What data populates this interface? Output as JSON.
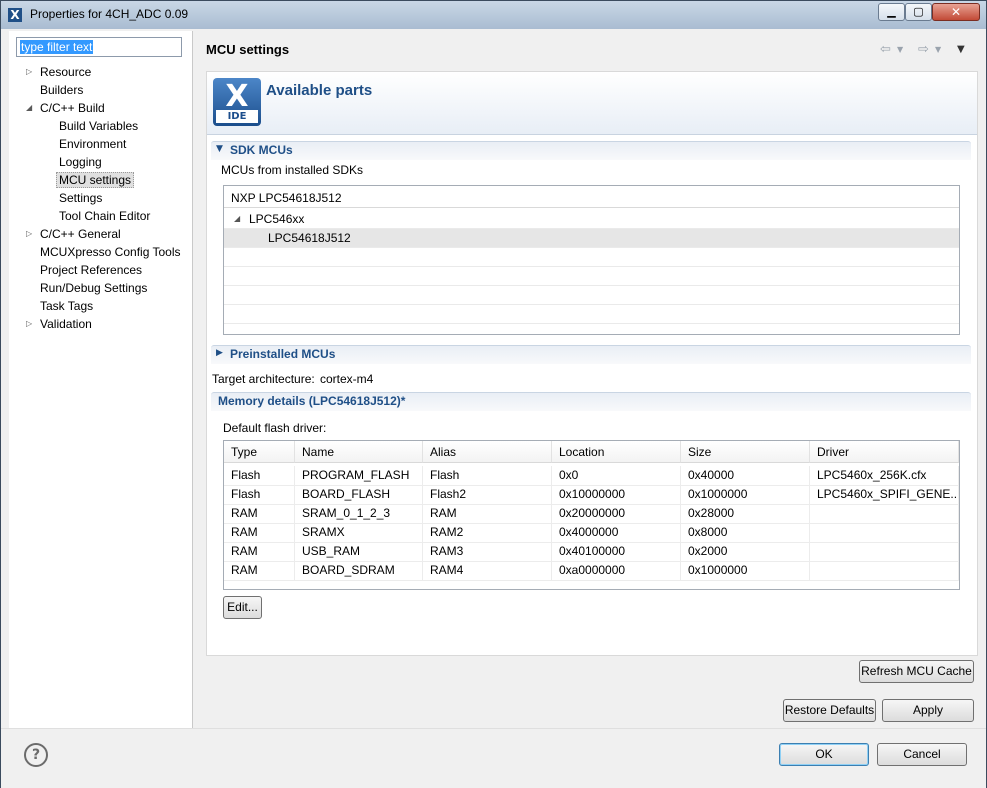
{
  "window": {
    "title": "Properties for 4CH_ADC 0.09"
  },
  "filter": {
    "placeholder": "type filter text"
  },
  "tree": [
    {
      "label": "Resource",
      "level": 0,
      "twisty": "collapsed"
    },
    {
      "label": "Builders",
      "level": 0,
      "twisty": "none"
    },
    {
      "label": "C/C++ Build",
      "level": 0,
      "twisty": "expanded"
    },
    {
      "label": "Build Variables",
      "level": 1,
      "twisty": "none"
    },
    {
      "label": "Environment",
      "level": 1,
      "twisty": "none"
    },
    {
      "label": "Logging",
      "level": 1,
      "twisty": "none"
    },
    {
      "label": "MCU settings",
      "level": 1,
      "twisty": "none",
      "selected": true
    },
    {
      "label": "Settings",
      "level": 1,
      "twisty": "none"
    },
    {
      "label": "Tool Chain Editor",
      "level": 1,
      "twisty": "none"
    },
    {
      "label": "C/C++ General",
      "level": 0,
      "twisty": "collapsed"
    },
    {
      "label": "MCUXpresso Config Tools",
      "level": 0,
      "twisty": "none"
    },
    {
      "label": "Project References",
      "level": 0,
      "twisty": "none"
    },
    {
      "label": "Run/Debug Settings",
      "level": 0,
      "twisty": "none"
    },
    {
      "label": "Task Tags",
      "level": 0,
      "twisty": "none"
    },
    {
      "label": "Validation",
      "level": 0,
      "twisty": "collapsed"
    }
  ],
  "page": {
    "title": "MCU settings"
  },
  "banner": {
    "logo_letter": "X",
    "logo_text": "IDE",
    "heading": "Available parts"
  },
  "sdk": {
    "header": "SDK MCUs",
    "subtitle": "MCUs from installed SDKs",
    "tree_header": "NXP LPC54618J512",
    "family": "LPC546xx",
    "part": "LPC54618J512"
  },
  "preinstalled": {
    "header": "Preinstalled MCUs"
  },
  "target": {
    "label": "Target architecture:",
    "value": "cortex-m4"
  },
  "memory": {
    "header": "Memory details (LPC54618J512)*",
    "flash_driver_label": "Default flash driver:",
    "columns": [
      "Type",
      "Name",
      "Alias",
      "Location",
      "Size",
      "Driver"
    ],
    "rows": [
      [
        "Flash",
        "PROGRAM_FLASH",
        "Flash",
        "0x0",
        "0x40000",
        "LPC5460x_256K.cfx"
      ],
      [
        "Flash",
        "BOARD_FLASH",
        "Flash2",
        "0x10000000",
        "0x1000000",
        "LPC5460x_SPIFI_GENE..."
      ],
      [
        "RAM",
        "SRAM_0_1_2_3",
        "RAM",
        "0x20000000",
        "0x28000",
        ""
      ],
      [
        "RAM",
        "SRAMX",
        "RAM2",
        "0x4000000",
        "0x8000",
        ""
      ],
      [
        "RAM",
        "USB_RAM",
        "RAM3",
        "0x40100000",
        "0x2000",
        ""
      ],
      [
        "RAM",
        "BOARD_SDRAM",
        "RAM4",
        "0xa0000000",
        "0x1000000",
        ""
      ]
    ],
    "edit_label": "Edit..."
  },
  "buttons": {
    "refresh": "Refresh MCU Cache",
    "restore": "Restore Defaults",
    "apply": "Apply",
    "ok": "OK",
    "cancel": "Cancel"
  },
  "icons": {
    "help": "?",
    "back": "⇦",
    "forward": "⇨"
  }
}
